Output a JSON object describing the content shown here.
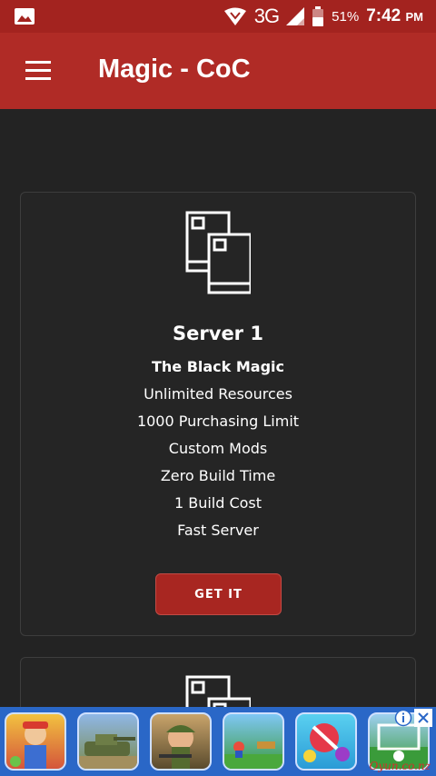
{
  "status_bar": {
    "network": "3G",
    "battery_percent": "51%",
    "time": "7:42",
    "time_suffix": "PM"
  },
  "app_bar": {
    "title": "Magic - CoC"
  },
  "cards": [
    {
      "title": "Server 1",
      "features": [
        "The Black Magic",
        "Unlimited Resources",
        "1000 Purchasing Limit",
        "Custom Mods",
        "Zero Build Time",
        "1 Build Cost",
        "Fast Server"
      ],
      "button_label": "GET IT"
    }
  ],
  "ad_banner": {
    "watermark": "Oyun.co.nz",
    "apps": [
      "subway-surfers-icon",
      "tank-game-icon",
      "soldier-game-icon",
      "platformer-game-icon",
      "candy-game-icon",
      "soccer-game-icon"
    ],
    "colors": {
      "background": "#2a67c7"
    }
  },
  "colors": {
    "status_bar": "#a3231f",
    "app_bar": "#b02b26",
    "background": "#232323",
    "button": "#a82621"
  }
}
